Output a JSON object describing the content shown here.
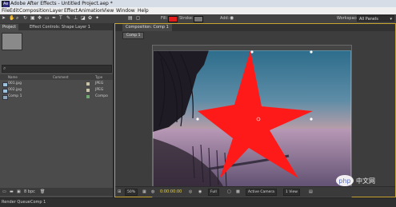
{
  "window": {
    "title": "Adobe After Effects - Untitled Project.aep *"
  },
  "menubar": {
    "items": [
      "File",
      "Edit",
      "Composition",
      "Layer",
      "Effect",
      "Animation",
      "View",
      "Window",
      "Help"
    ]
  },
  "toolbar": {
    "fill_label": "Fill:",
    "stroke_label": "Stroke:",
    "add_label": "Add:",
    "workspace_label": "Workspace:",
    "workspace_value": "All Panels"
  },
  "project_panel": {
    "tab_project": "Project",
    "tab_effect_controls": "Effect Controls: Shape Layer 1",
    "columns": {
      "name": "Name",
      "comment": "Comment",
      "type": "Type"
    },
    "rows": [
      {
        "name": "001.jpg",
        "type": "JPEG"
      },
      {
        "name": "002.jpg",
        "type": "JPEG"
      },
      {
        "name": "Comp 1",
        "type": "Compo"
      }
    ],
    "bpc": "8 bpc"
  },
  "composition_panel": {
    "tab_label": "Composition: Comp 1",
    "breadcrumb": "Comp 1",
    "zoom": "50%",
    "timecode": "0:00:00:00",
    "resolution": "Full",
    "camera": "Active Camera",
    "views": "1 View"
  },
  "bottom_strip": {
    "render_queue": "Render Queue",
    "comp_tab": "Comp 1"
  },
  "watermark": {
    "text": "php 中文网"
  },
  "colors": {
    "star": "#ff1a1a",
    "accent": "#c8a530",
    "fill_swatch": "#e21b1b"
  }
}
